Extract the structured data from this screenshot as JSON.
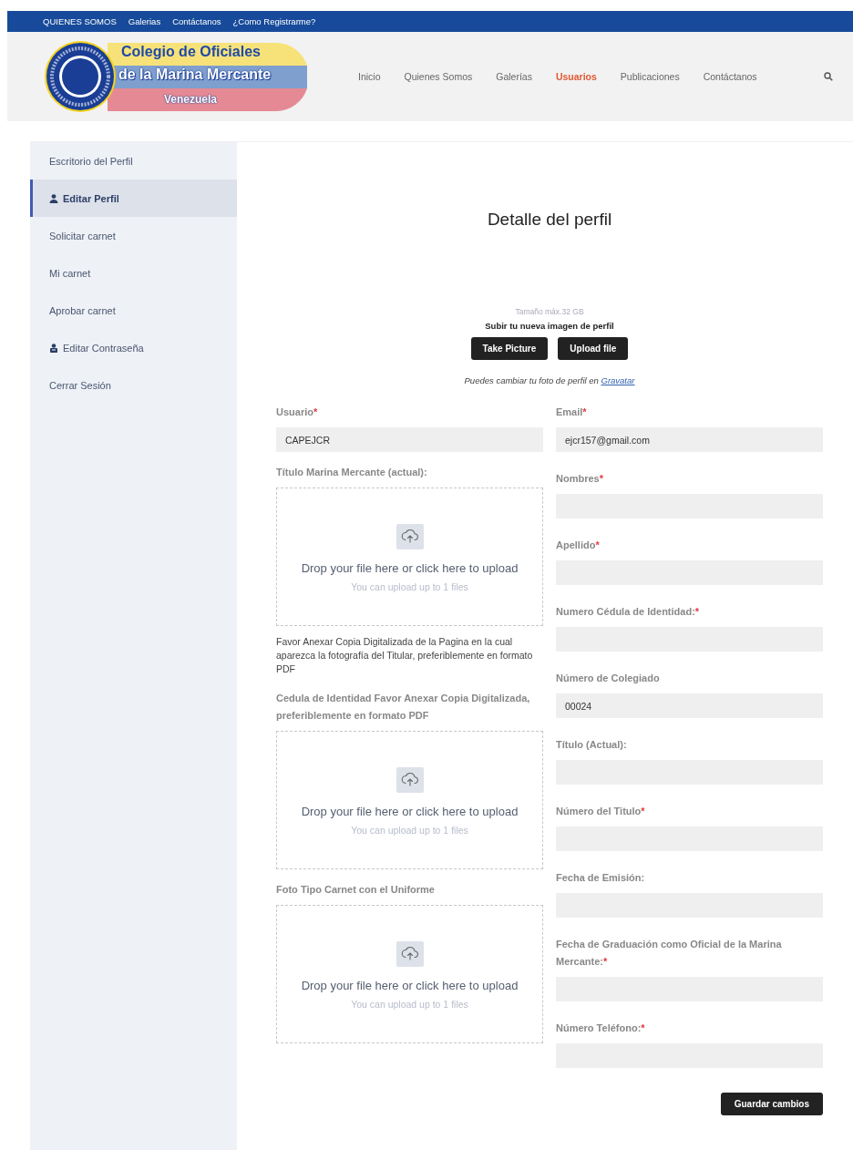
{
  "top_bar": {
    "links": [
      "QUIENES SOMOS",
      "Galerias",
      "Contáctanos",
      "¿Como Registrarme?"
    ]
  },
  "logo": {
    "line_1": "Colegio de Oficiales",
    "line_2": "de la Marina Mercante",
    "line_3": "Venezuela"
  },
  "nav": [
    {
      "label": "Inicio",
      "selected": false
    },
    {
      "label": "Quienes Somos",
      "selected": false
    },
    {
      "label": "Galerías",
      "selected": false
    },
    {
      "label": "Usuarios",
      "selected": true
    },
    {
      "label": "Publicaciones",
      "selected": false
    },
    {
      "label": "Contáctanos",
      "selected": false
    }
  ],
  "sidebar": {
    "items": [
      {
        "label": "Escritorio del Perfil",
        "kind": "plain",
        "selected": false
      },
      {
        "label": "Editar Perfil",
        "kind": "profile",
        "selected": true
      },
      {
        "label": "Solicitar carnet",
        "kind": "plain",
        "selected": false
      },
      {
        "label": "Mi carnet",
        "kind": "plain",
        "selected": false
      },
      {
        "label": "Aprobar carnet",
        "kind": "plain",
        "selected": false
      },
      {
        "label": "Editar Contraseña",
        "kind": "password",
        "selected": false
      },
      {
        "label": "Cerrar Sesión",
        "kind": "plain",
        "selected": false
      }
    ]
  },
  "title": "Detalle del perfil",
  "avatar_upload": {
    "size_note": "Tamaño máx.32 GB",
    "heading": "Subir tu nueva imagen de perfil",
    "buttons": [
      "Take Picture",
      "Upload file"
    ],
    "gravatar_text": "Puedes cambiar tu foto de perfil en",
    "gravatar_link": "Gravatar"
  },
  "left_column": [
    {
      "kind": "field",
      "label": "Usuario",
      "required_mark": "*",
      "value": "CAPEJCR"
    },
    {
      "kind": "dropzone",
      "label": "Título Marina Mercante (actual):",
      "prompt": "Drop your file here or click here to upload",
      "hint": "You can upload up to 1 files"
    },
    {
      "kind": "note",
      "text": "Favor Anexar Copia Digitalizada de la Pagina en la cual aparezca la fotografía del Titular, preferiblemente en formato PDF"
    },
    {
      "kind": "dropzone",
      "label": "Cedula de Identidad Favor Anexar Copia Digitalizada, preferiblemente en formato PDF",
      "prompt": "Drop your file here or click here to upload",
      "hint": "You can upload up to 1 files"
    },
    {
      "kind": "dropzone",
      "label": "Foto Tipo Carnet con el Uniforme",
      "prompt": "Drop your file here or click here to upload",
      "hint": "You can upload up to 1 files"
    }
  ],
  "right_column": [
    {
      "kind": "field",
      "label": "Email",
      "required_mark": "*",
      "value": "ejcr157@gmail.com"
    },
    {
      "kind": "field",
      "label": "Nombres",
      "required_mark": "*"
    },
    {
      "kind": "field",
      "label": "Apellido",
      "required_mark": "*"
    },
    {
      "kind": "field",
      "label": "Numero Cédula de Identidad:",
      "required_mark": "*"
    },
    {
      "kind": "field",
      "label": "Número de Colegiado",
      "value": "00024"
    },
    {
      "kind": "field",
      "label": "Título (Actual):"
    },
    {
      "kind": "field",
      "label": "Número del Titulo",
      "required_mark": "*"
    },
    {
      "kind": "field",
      "label": "Fecha de Emisión:"
    },
    {
      "kind": "field",
      "label": "Fecha de Graduación como Oficial de la Marina Mercante:",
      "required_mark": "*"
    },
    {
      "kind": "field",
      "label": "Número Teléfono:",
      "required_mark": "*"
    }
  ],
  "save_button": "Guardar cambios"
}
